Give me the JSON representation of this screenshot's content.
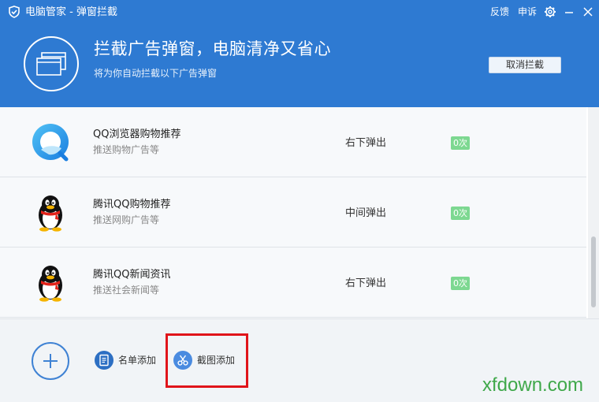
{
  "window": {
    "title": "电脑管家 - 弹窗拦截",
    "links": {
      "feedback": "反馈",
      "appeal": "申诉"
    },
    "icons": {
      "logo": "shield-icon",
      "settings": "gear-icon",
      "minimize": "minimize-icon",
      "close": "close-icon"
    }
  },
  "hero": {
    "title": "拦截广告弹窗，电脑清净又省心",
    "subtitle": "将为你自动拦截以下广告弹窗",
    "cancel_label": "取消拦截",
    "icon": "popup-window-icon"
  },
  "rows": [
    {
      "title": "QQ浏览器购物推荐",
      "desc": "推送购物广告等",
      "position": "右下弹出",
      "count": "0次",
      "icon": "qq-browser-icon"
    },
    {
      "title": "腾讯QQ购物推荐",
      "desc": "推送网购广告等",
      "position": "中间弹出",
      "count": "0次",
      "icon": "qq-penguin-icon"
    },
    {
      "title": "腾讯QQ新闻资讯",
      "desc": "推送社会新闻等",
      "position": "右下弹出",
      "count": "0次",
      "icon": "qq-penguin-icon"
    }
  ],
  "footer": {
    "list_add_label": "名单添加",
    "screenshot_add_label": "截图添加",
    "watermark": "xfdown.com"
  },
  "colors": {
    "header_blue": "#2e7ad2",
    "count_badge": "#7dd891",
    "highlight": "#e0141a",
    "watermark": "#3fa84a"
  }
}
